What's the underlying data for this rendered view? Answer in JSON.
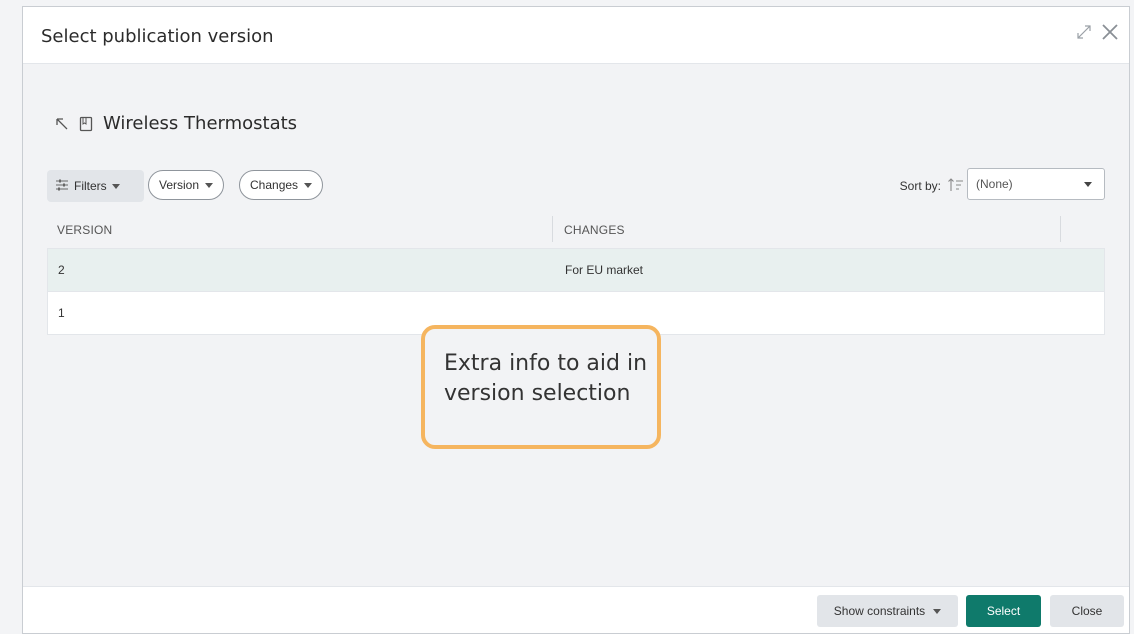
{
  "dialog": {
    "title": "Select publication version",
    "expand_icon": "expand-diagonal-icon",
    "close_icon": "close-icon"
  },
  "breadcrumb": {
    "up_icon": "arrow-up-left-icon",
    "doc_icon": "book-icon",
    "name": "Wireless Thermostats"
  },
  "toolbar": {
    "filters_label": "Filters",
    "filters_icon": "sliders-icon",
    "pills": [
      {
        "label": "Version"
      },
      {
        "label": "Changes"
      }
    ],
    "sort_label": "Sort by:",
    "sort_icon": "sort-ascending-icon",
    "sort_value": "(None)"
  },
  "table": {
    "columns": [
      "VERSION",
      "CHANGES"
    ],
    "rows": [
      {
        "version": "2",
        "changes": "For EU market",
        "selected": true
      },
      {
        "version": "1",
        "changes": "",
        "selected": false
      }
    ]
  },
  "callout": {
    "text": "Extra info to aid in version selection",
    "border_color": "#f5b55f"
  },
  "footer": {
    "show_constraints_label": "Show constraints",
    "select_label": "Select",
    "close_label": "Close"
  },
  "colors": {
    "primary": "#0f7a6b",
    "selected_row": "#e8f0ef"
  }
}
